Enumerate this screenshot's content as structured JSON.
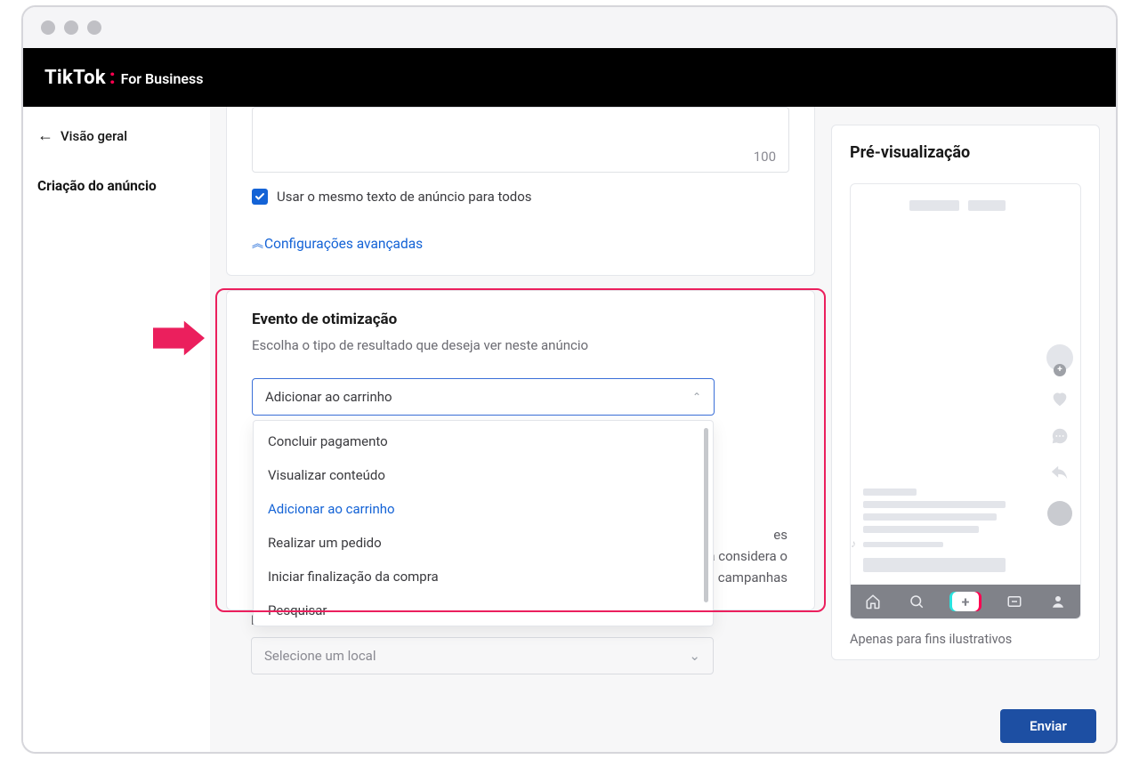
{
  "header": {
    "brand_part1": "TikTok",
    "brand_part2": "For Business"
  },
  "sidebar": {
    "back_label": "Visão geral",
    "step_label": "Criação do anúncio"
  },
  "top_card": {
    "char_counter": "100",
    "checkbox_label": "Usar o mesmo texto de anúncio para todos",
    "advanced_link": "Configurações avançadas"
  },
  "event_card": {
    "title": "Evento de otimização",
    "subtitle": "Escolha o tipo de resultado que deseja ver neste anúncio",
    "selected": "Adicionar ao carrinho",
    "options": [
      "Concluir pagamento",
      "Visualizar conteúdo",
      "Adicionar ao carrinho",
      "Realizar um pedido",
      "Iniciar finalização da compra",
      "Pesquisar"
    ],
    "behind_fragments": [
      "es",
      "a considera o",
      "campanhas"
    ]
  },
  "local_card": {
    "label": "Local",
    "placeholder": "Selecione um local"
  },
  "preview": {
    "title": "Pré-visualização",
    "note": "Apenas para fins ilustrativos"
  },
  "submit_label": "Enviar"
}
